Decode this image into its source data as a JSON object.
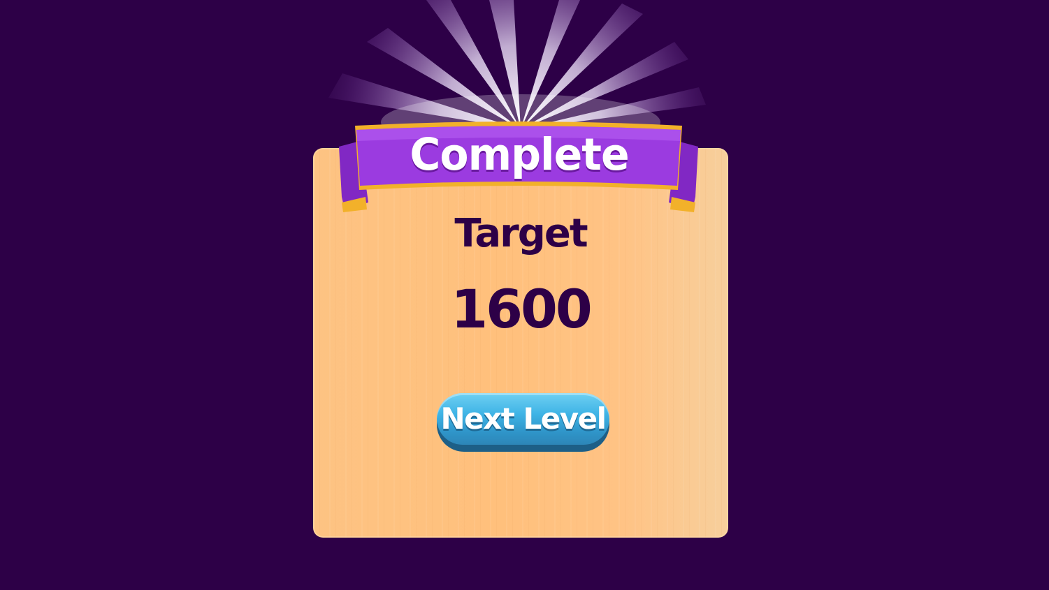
{
  "dialog": {
    "title": "Complete",
    "target_label": "Target",
    "target_value": "1600",
    "next_button_label": "Next Level"
  },
  "colors": {
    "background": "#2d0047",
    "panel": "#ffc07c",
    "ribbon": "#9b3be0",
    "ribbon_trim": "#f2b12a",
    "text_dark": "#2d0047",
    "button": "#3fb4e6"
  },
  "icons": {
    "light_rays": "light-rays-icon",
    "ribbon": "ribbon-banner"
  }
}
